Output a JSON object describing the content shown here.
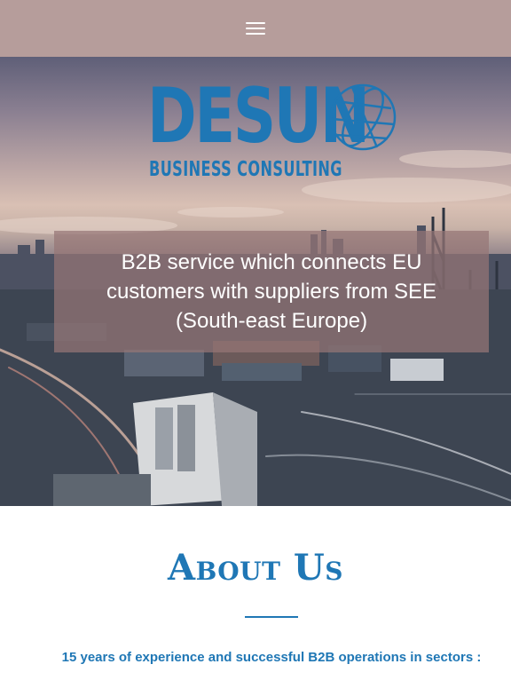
{
  "nav": {
    "menu_icon": "hamburger-menu-icon"
  },
  "hero": {
    "logo_word": "DESUN",
    "logo_sub": "BUSINESS CONSULTING",
    "logo_icon": "globe-icon",
    "tagline": "B2B service which connects EU customers with suppliers from SEE (South-east Europe)"
  },
  "about": {
    "title": "About Us",
    "lead": "15 years of experience and successful B2B operations in sectors :"
  },
  "colors": {
    "brand_blue": "#1f77b5",
    "topbar": "#b69d9b",
    "overlay": "#967676"
  }
}
